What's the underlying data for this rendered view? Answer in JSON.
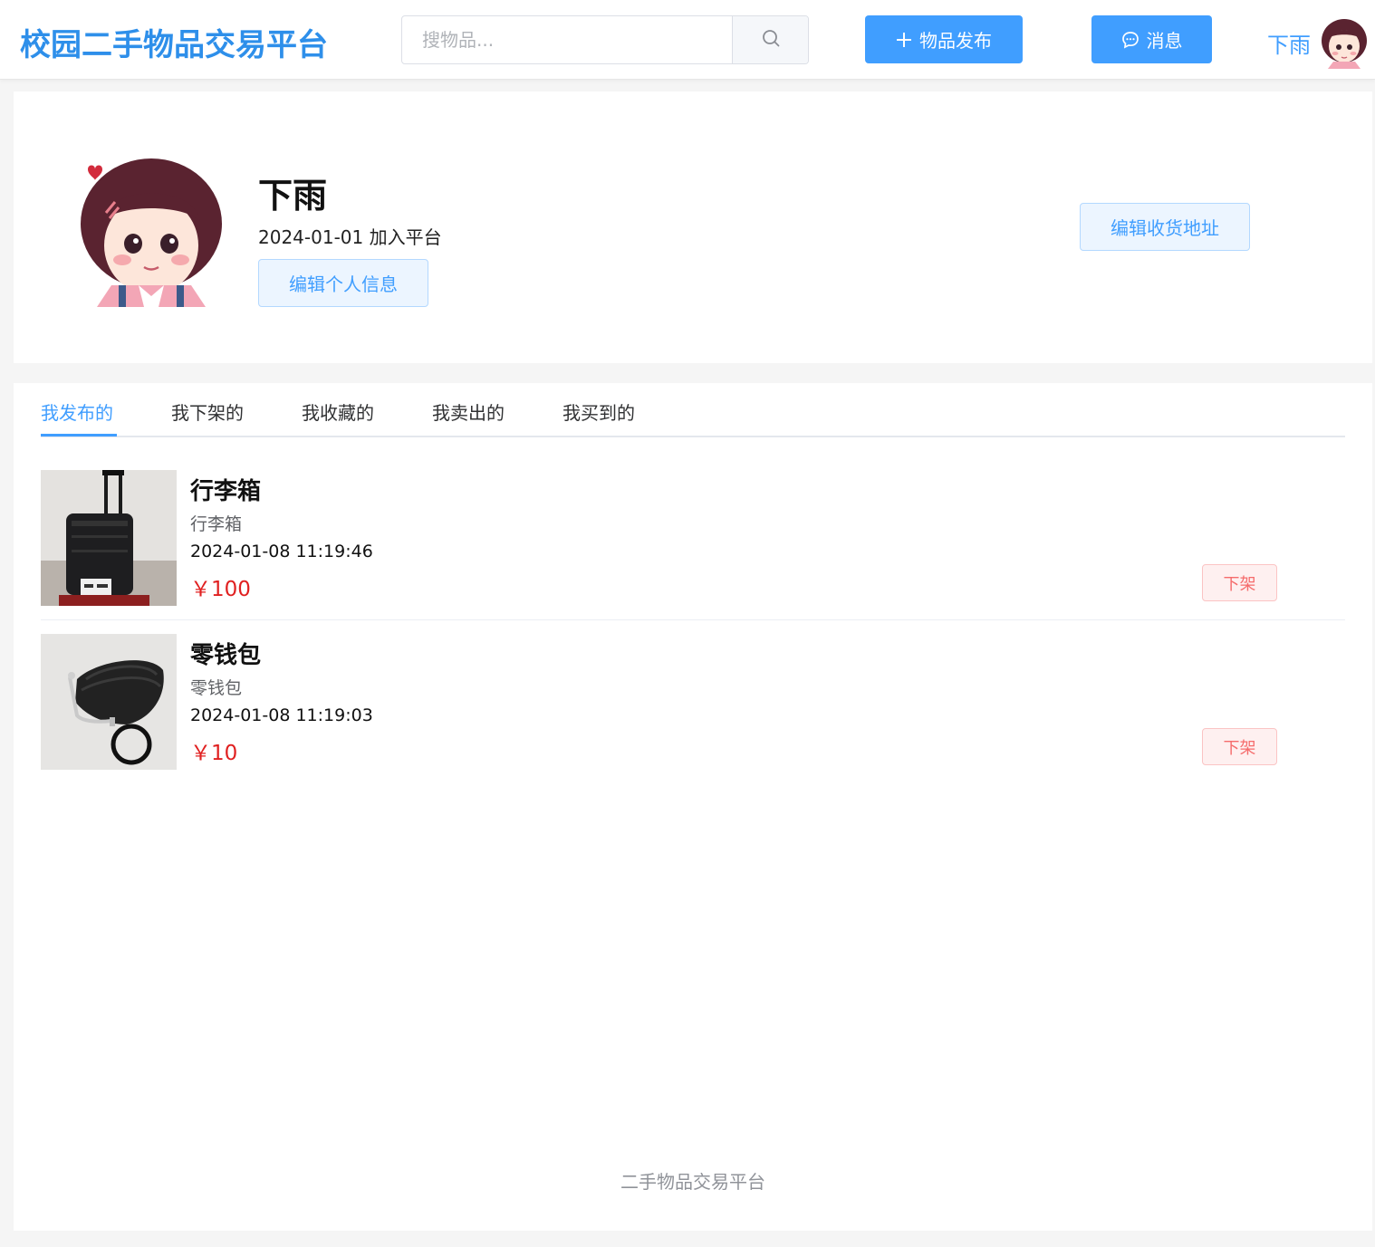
{
  "header": {
    "logo": "校园二手物品交易平台",
    "search_placeholder": "搜物品...",
    "publish_label": "物品发布",
    "message_label": "消息",
    "username": "下雨"
  },
  "profile": {
    "name": "下雨",
    "joined": "2024-01-01 加入平台",
    "edit_profile_label": "编辑个人信息",
    "edit_address_label": "编辑收货地址"
  },
  "tabs": [
    {
      "label": "我发布的",
      "active": true
    },
    {
      "label": "我下架的",
      "active": false
    },
    {
      "label": "我收藏的",
      "active": false
    },
    {
      "label": "我卖出的",
      "active": false
    },
    {
      "label": "我买到的",
      "active": false
    }
  ],
  "items": [
    {
      "title": "行李箱",
      "desc": "行李箱",
      "time": "2024-01-08 11:19:46",
      "price": "￥100",
      "action": "下架"
    },
    {
      "title": "零钱包",
      "desc": "零钱包",
      "time": "2024-01-08 11:19:03",
      "price": "￥10",
      "action": "下架"
    }
  ],
  "footer": "二手物品交易平台",
  "colors": {
    "brand": "#409eff",
    "logo": "#2e8fea",
    "price": "#e02020",
    "danger": "#f56c6c"
  }
}
